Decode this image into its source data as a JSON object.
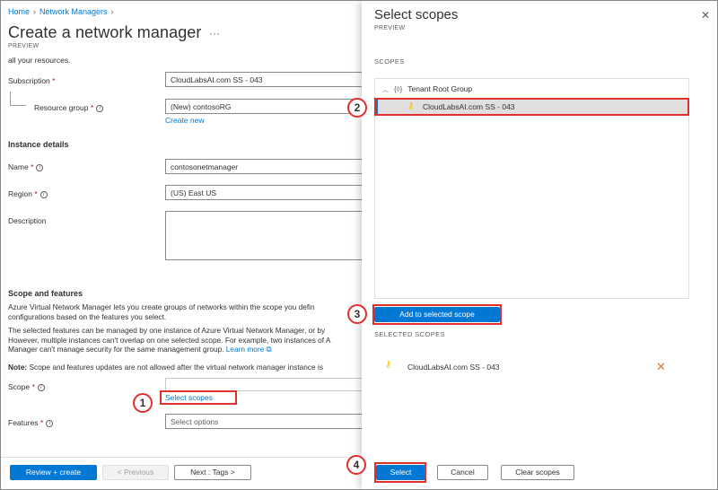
{
  "breadcrumb": {
    "items": [
      "Home",
      "Network Managers"
    ]
  },
  "page": {
    "title": "Create a network manager",
    "preview": "PREVIEW",
    "cut_text": "all your resources.",
    "subscription": {
      "label": "Subscription",
      "value": "CloudLabsAI.com SS - 043"
    },
    "resource_group": {
      "label": "Resource group",
      "value": "(New) contosoRG",
      "create_link": "Create new"
    },
    "instance_heading": "Instance details",
    "name": {
      "label": "Name",
      "value": "contosonetmanager"
    },
    "region": {
      "label": "Region",
      "value": "(US) East US"
    },
    "description": {
      "label": "Description",
      "value": ""
    },
    "scope_heading": "Scope and features",
    "para1_line1": "Azure Virtual Network Manager lets you create groups of networks within the scope you defin",
    "para1_line2": "configurations based on the features you select.",
    "para2_line1": "The selected features can be managed by one instance of Azure Virtual Network Manager, or by",
    "para2_line2": "However, multiple instances can't overlap on one selected scope. For example, two instances of A",
    "para2_line3": "Manager can't manage security for the same management group.",
    "learn_more": "Learn more",
    "note_bold": "Note:",
    "note_text": " Scope and features updates are not allowed after the virtual network manager instance is",
    "scope": {
      "label": "Scope",
      "link": "Select scopes"
    },
    "features": {
      "label": "Features",
      "placeholder": "Select options"
    }
  },
  "footer": {
    "review_create": "Review + create",
    "previous": "< Previous",
    "next": "Next : Tags >"
  },
  "panel": {
    "title": "Select scopes",
    "preview": "PREVIEW",
    "scopes_heading": "SCOPES",
    "root_group": "Tenant Root Group",
    "subscription_item": "CloudLabsAI.com SS - 043",
    "add_button": "Add to selected scope",
    "selected_heading": "SELECTED SCOPES",
    "selected_item": "CloudLabsAI.com SS - 043",
    "select_button": "Select",
    "cancel_button": "Cancel",
    "clear_button": "Clear scopes"
  },
  "callouts": [
    "1",
    "2",
    "3",
    "4"
  ],
  "colors": {
    "accent": "#0078d4",
    "callout": "#e0302d",
    "key_icon": "#f8c100"
  }
}
